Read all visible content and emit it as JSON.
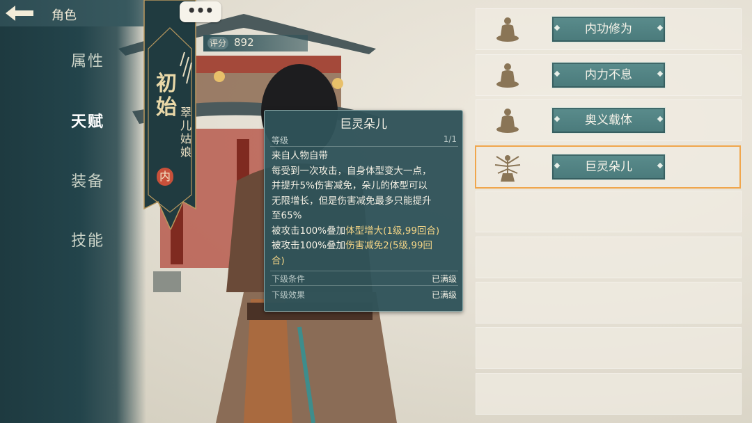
{
  "header": {
    "title": "角色"
  },
  "sidebar": {
    "items": [
      {
        "label": "属性",
        "active": false
      },
      {
        "label": "天赋",
        "active": true
      },
      {
        "label": "装备",
        "active": false
      },
      {
        "label": "技能",
        "active": false
      }
    ]
  },
  "character": {
    "rank": "初始",
    "name": "翠儿姑娘",
    "type_badge": "内",
    "score_label": "评分",
    "score": "892",
    "chat_icon": "ellipsis-bubble-icon"
  },
  "tooltip": {
    "title": "巨灵朵儿",
    "level_label": "等级",
    "level_value": "1/1",
    "lines": [
      {
        "text": "来自人物自带",
        "highlight": false
      },
      {
        "text": "每受到一次攻击，自身体型变大一点，",
        "highlight": false
      },
      {
        "text": "并提升5%伤害减免，朵儿的体型可以",
        "highlight": false
      },
      {
        "text": "无限增长，但是伤害减免最多只能提升",
        "highlight": false
      },
      {
        "text": "至65%",
        "highlight": false
      },
      {
        "text_a": "被攻击100%叠加",
        "text_b": "体型增大",
        "text_c": "(1级,99回合)"
      },
      {
        "text_a": "被攻击100%叠加",
        "text_b": "伤害减免2",
        "text_c": "(5级,99回"
      },
      {
        "text": "合)",
        "highlight": false
      }
    ],
    "next_condition_label": "下级条件",
    "next_condition_value": "已满级",
    "next_effect_label": "下级效果",
    "next_effect_value": "已满级"
  },
  "skills": [
    {
      "label": "内功修为",
      "icon": "meditating-monk-icon",
      "selected": false
    },
    {
      "label": "内力不息",
      "icon": "meditating-monk-icon",
      "selected": false
    },
    {
      "label": "奥义载体",
      "icon": "meditating-monk-icon",
      "selected": false
    },
    {
      "label": "巨灵朵儿",
      "icon": "multi-armed-deity-icon",
      "selected": true
    }
  ],
  "colors": {
    "sidebar": "#23444b",
    "tooltip_bg": "#2f5258",
    "skill_button": "#4f8283",
    "selected_border": "#f0a64c",
    "highlight_text": "#f2d486"
  }
}
